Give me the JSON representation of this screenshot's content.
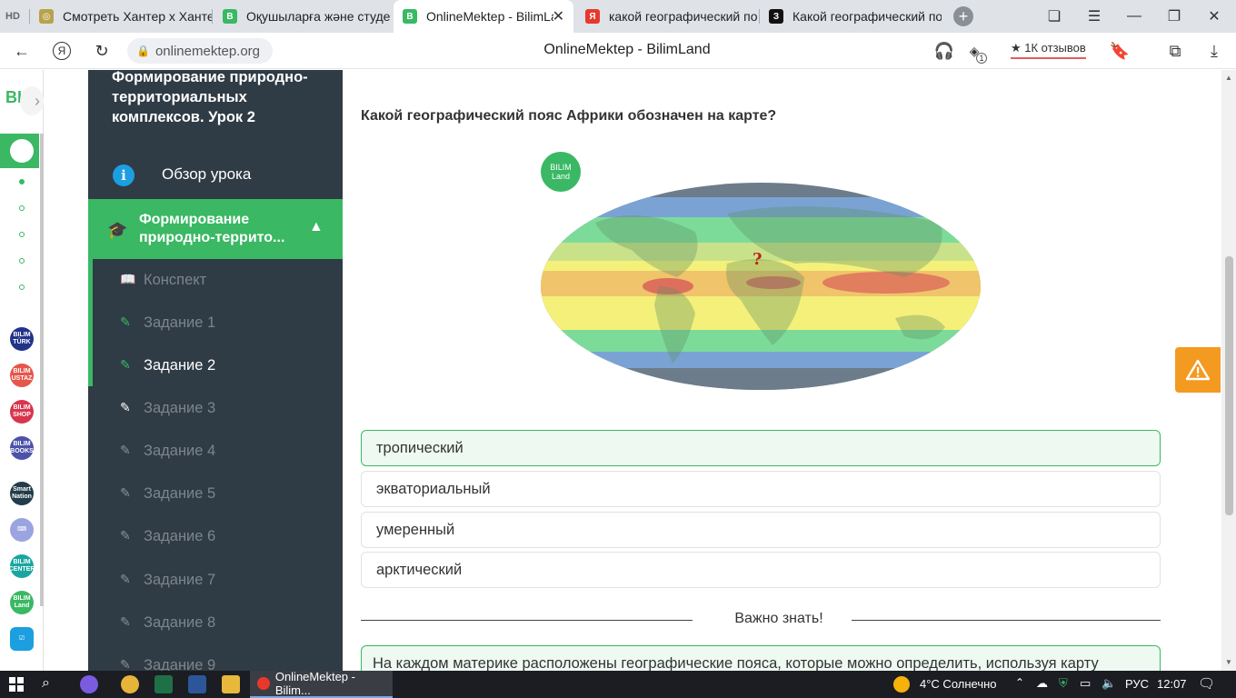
{
  "browser": {
    "tabs": [
      {
        "label": "Смотреть Хантер х Хантер",
        "active": false
      },
      {
        "label": "Оқушыларға және студенттер",
        "active": false
      },
      {
        "label": "OnlineMektep - BilimLand",
        "active": true
      },
      {
        "label": "какой географический по",
        "active": false
      },
      {
        "label": "Какой географический по",
        "active": false
      }
    ],
    "url": "onlinemektep.org",
    "page_title": "OnlineMektep - BilimLand",
    "reviews_label": "★ 1К отзывов",
    "notification_count": "1"
  },
  "rail": {
    "logo": "BL",
    "badges": [
      "BILIM TÜRK",
      "BILIM USTAZ",
      "BILIM SHOP",
      "BILIM BOOKS",
      "Smart Nation",
      "",
      "BILIM CENTER",
      "BILIM Land",
      ""
    ]
  },
  "sidebar": {
    "lesson_title": "Формирование природно-территориальных комплексов. Урок 2",
    "overview_label": "Обзор урока",
    "section_label": "Формирование природно-террито...",
    "items": [
      {
        "label": "Конспект"
      },
      {
        "label": "Задание 1"
      },
      {
        "label": "Задание 2"
      },
      {
        "label": "Задание 3"
      },
      {
        "label": "Задание 4"
      },
      {
        "label": "Задание 5"
      },
      {
        "label": "Задание 6"
      },
      {
        "label": "Задание 7"
      },
      {
        "label": "Задание 8"
      },
      {
        "label": "Задание 9"
      }
    ]
  },
  "main": {
    "question": "Какой географический пояс Африки обозначен на карте?",
    "map_logo": "BILIM Land",
    "map_marker": "?",
    "answers": [
      {
        "label": "тропический",
        "selected": true
      },
      {
        "label": "экваториальный",
        "selected": false
      },
      {
        "label": "умеренный",
        "selected": false
      },
      {
        "label": "арктический",
        "selected": false
      }
    ],
    "important_label": "Важно знать!",
    "info_text": "На каждом материке расположены географические пояса, которые можно определить, используя карту"
  },
  "taskbar": {
    "active_window": "OnlineMektep - Bilim...",
    "weather": "4°C Солнечно",
    "language": "РУС",
    "time": "12:07"
  },
  "colors": {
    "accent_green": "#3ab864",
    "sidebar_bg": "#2f3b45",
    "warning_orange": "#f39a21"
  }
}
